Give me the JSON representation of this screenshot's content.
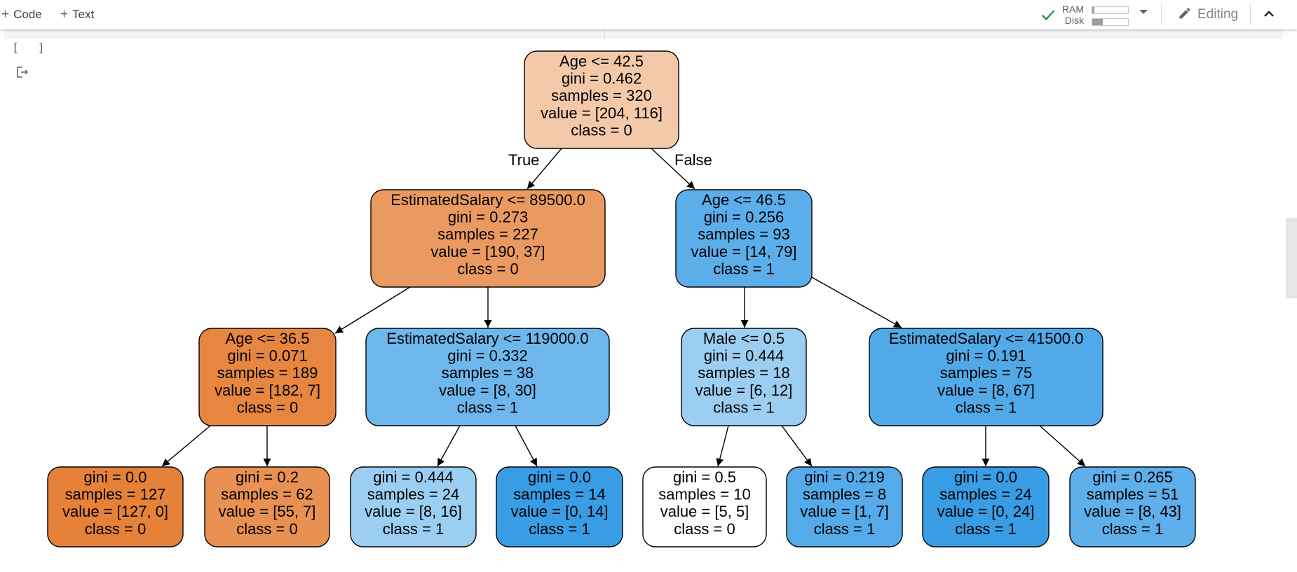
{
  "toolbar": {
    "code_label": "Code",
    "text_label": "Text",
    "ram_label": "RAM",
    "disk_label": "Disk",
    "ram_usage_fraction": 0.05,
    "disk_usage_fraction": 0.3,
    "mode_label": "Editing",
    "status_color": "#1e8e3e"
  },
  "cell": {
    "run_indicator": "[ ]"
  },
  "tree": {
    "edge_labels": {
      "true_label": "True",
      "false_label": "False"
    },
    "nodes": [
      {
        "id": "n0",
        "lines": [
          "Age <= 42.5",
          "gini = 0.462",
          "samples = 320",
          "value = [204, 116]",
          "class = 0"
        ],
        "color": "#f4c9aa"
      },
      {
        "id": "n1",
        "lines": [
          "EstimatedSalary <= 89500.0",
          "gini = 0.273",
          "samples = 227",
          "value = [190, 37]",
          "class = 0"
        ],
        "color": "#ea9a60"
      },
      {
        "id": "n2",
        "lines": [
          "Age <= 46.5",
          "gini = 0.256",
          "samples = 93",
          "value = [14, 79]",
          "class = 1"
        ],
        "color": "#5caeea"
      },
      {
        "id": "n3",
        "lines": [
          "Age <= 36.5",
          "gini = 0.071",
          "samples = 189",
          "value = [182, 7]",
          "class = 0"
        ],
        "color": "#e68640"
      },
      {
        "id": "n4",
        "lines": [
          "EstimatedSalary <= 119000.0",
          "gini = 0.332",
          "samples = 38",
          "value = [8, 30]",
          "class = 1"
        ],
        "color": "#6eb7ec"
      },
      {
        "id": "n5",
        "lines": [
          "Male <= 0.5",
          "gini = 0.444",
          "samples = 18",
          "value = [6, 12]",
          "class = 1"
        ],
        "color": "#9ccef2"
      },
      {
        "id": "n6",
        "lines": [
          "EstimatedSalary <= 41500.0",
          "gini = 0.191",
          "samples = 75",
          "value = [8, 67]",
          "class = 1"
        ],
        "color": "#51a9e8"
      },
      {
        "id": "n7",
        "lines": [
          "gini = 0.0",
          "samples = 127",
          "value = [127, 0]",
          "class = 0"
        ],
        "color": "#e58139"
      },
      {
        "id": "n8",
        "lines": [
          "gini = 0.2",
          "samples = 62",
          "value = [55, 7]",
          "class = 0"
        ],
        "color": "#e89152"
      },
      {
        "id": "n9",
        "lines": [
          "gini = 0.444",
          "samples = 24",
          "value = [8, 16]",
          "class = 1"
        ],
        "color": "#9ccef2"
      },
      {
        "id": "n10",
        "lines": [
          "gini = 0.0",
          "samples = 14",
          "value = [0, 14]",
          "class = 1"
        ],
        "color": "#399de5"
      },
      {
        "id": "n11",
        "lines": [
          "gini = 0.5",
          "samples = 10",
          "value = [5, 5]",
          "class = 0"
        ],
        "color": "#ffffff"
      },
      {
        "id": "n12",
        "lines": [
          "gini = 0.219",
          "samples = 8",
          "value = [1, 7]",
          "class = 1"
        ],
        "color": "#55abe9"
      },
      {
        "id": "n13",
        "lines": [
          "gini = 0.0",
          "samples = 24",
          "value = [0, 24]",
          "class = 1"
        ],
        "color": "#399de5"
      },
      {
        "id": "n14",
        "lines": [
          "gini = 0.265",
          "samples = 51",
          "value = [8, 43]",
          "class = 1"
        ],
        "color": "#5eafea"
      }
    ],
    "edges": [
      [
        "n0",
        "n1"
      ],
      [
        "n0",
        "n2"
      ],
      [
        "n1",
        "n3"
      ],
      [
        "n1",
        "n4"
      ],
      [
        "n2",
        "n5"
      ],
      [
        "n2",
        "n6"
      ],
      [
        "n3",
        "n7"
      ],
      [
        "n3",
        "n8"
      ],
      [
        "n4",
        "n9"
      ],
      [
        "n4",
        "n10"
      ],
      [
        "n5",
        "n11"
      ],
      [
        "n5",
        "n12"
      ],
      [
        "n6",
        "n13"
      ],
      [
        "n6",
        "n14"
      ]
    ]
  }
}
